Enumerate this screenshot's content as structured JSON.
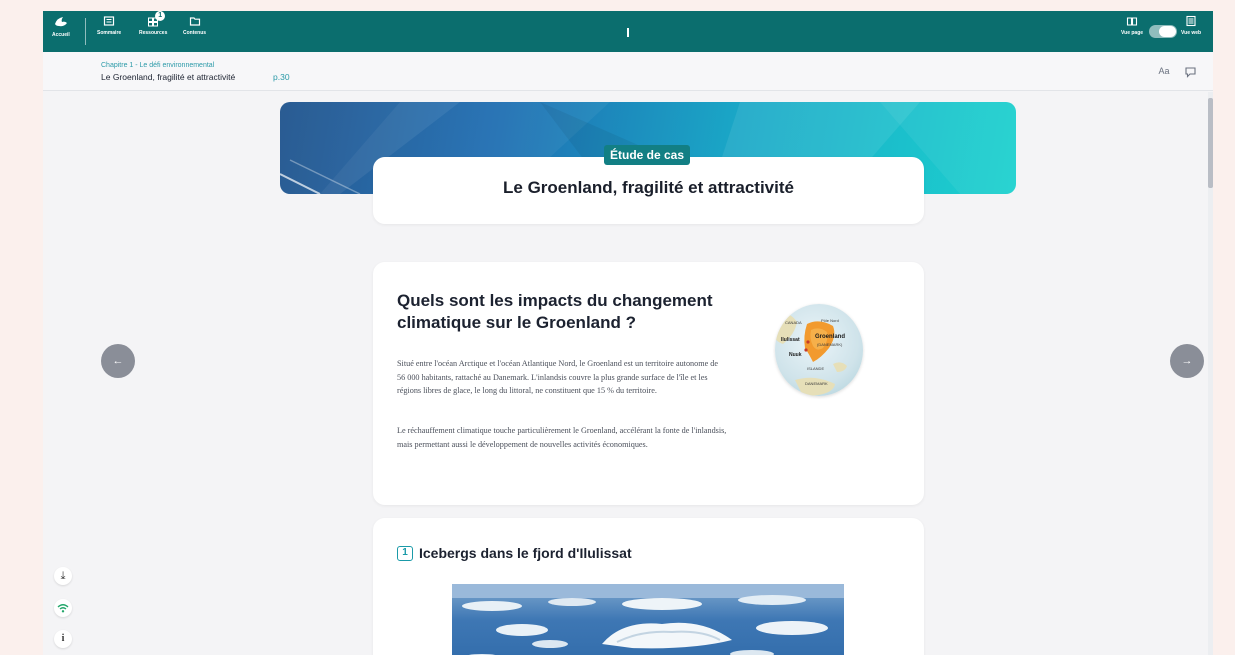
{
  "topbar": {
    "home_label": "Accueil",
    "summary_label": "Sommaire",
    "resources_label": "Ressources",
    "resources_badge": "1",
    "contents_label": "Contenus",
    "page_view_label": "Vue page",
    "web_view_label": "Vue web"
  },
  "breadcrumb": {
    "chapter": "Chapitre 1 - Le défi environnemental",
    "title": "Le Groenland, fragilité et attractivité",
    "page": "p.30",
    "font_size_icon": "Aa"
  },
  "header": {
    "tag": "Étude de cas",
    "title": "Le Groenland, fragilité et attractivité"
  },
  "intro": {
    "question": "Quels sont les impacts du changement climatique sur le Groenland ?",
    "paragraph1": "Situé entre l'océan Arctique et l'océan Atlantique Nord, le Groenland est un territoire autonome de 56 000 habitants, rattaché au Danemark. L'inlandsis couvre la plus grande surface de l'île et les régions libres de glace, le long du littoral, ne constituent que 15 % du territoire.",
    "paragraph2": "Le réchauffement climatique touche particulièrement le Groenland, accélérant la fonte de l'inlandsis, mais permettant aussi le développement de nouvelles activités économiques.",
    "map_labels": {
      "canada": "CANADA",
      "pole": "Pôle Nord",
      "greenland": "Groenland",
      "denmark_tag": "(DANEMARK)",
      "ilulissat": "Ilulissat",
      "nuuk": "Nuuk",
      "islande": "ISLANDE",
      "danemark": "DANEMARK"
    }
  },
  "document": {
    "number": "1",
    "title": "Icebergs dans le fjord d'Ilulissat"
  },
  "colors": {
    "topbar": "#0b6e6e",
    "accent": "#1a9aa8",
    "tag": "#127f84"
  }
}
